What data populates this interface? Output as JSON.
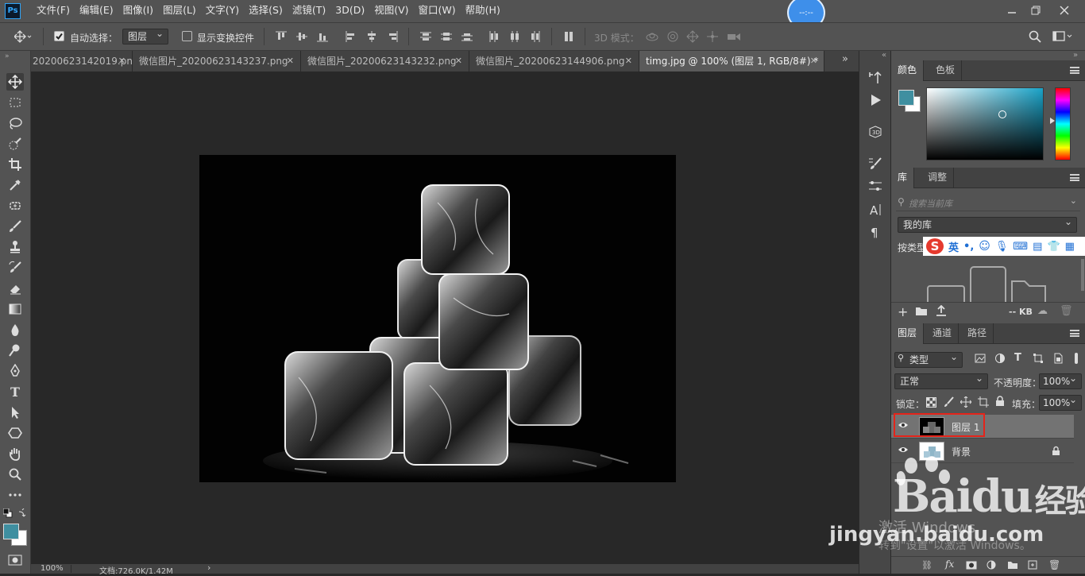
{
  "app": {
    "logo": "Ps",
    "clock": "--:--"
  },
  "menu": [
    "文件(F)",
    "编辑(E)",
    "图像(I)",
    "图层(L)",
    "文字(Y)",
    "选择(S)",
    "滤镜(T)",
    "3D(D)",
    "视图(V)",
    "窗口(W)",
    "帮助(H)"
  ],
  "options": {
    "auto_select_label": "自动选择：",
    "auto_select_checked": true,
    "auto_select_value": "图层",
    "show_transform_label": "显示变换控件",
    "show_transform_checked": false,
    "mode3d_label": "3D 模式："
  },
  "tabs": [
    {
      "label": "20200623142019.png",
      "active": false
    },
    {
      "label": "微信图片_20200623143237.png",
      "active": false
    },
    {
      "label": "微信图片_20200623143232.png",
      "active": false
    },
    {
      "label": "微信图片_20200623144906.png",
      "active": false
    },
    {
      "label": "timg.jpg @ 100% (图层 1, RGB/8#) *",
      "active": true
    }
  ],
  "status": {
    "zoom": "100%",
    "doc": "文档:726.0K/1.42M"
  },
  "colors": {
    "foreground": "#3f8fa0",
    "background": "#ffffff",
    "picker_hue": "#1aa3c8"
  },
  "color_panel": {
    "tabs": [
      "颜色",
      "色板"
    ]
  },
  "library_panel": {
    "tabs": [
      "库",
      "调整"
    ],
    "search_placeholder": "搜索当前库",
    "library_name": "我的库",
    "group_by": "按类型",
    "size": "-- KB"
  },
  "ime": [
    "英",
    "•,"
  ],
  "layers_panel": {
    "tabs": [
      "图层",
      "通道",
      "路径"
    ],
    "filter": "类型",
    "blend": "正常",
    "opacity_label": "不透明度：",
    "opacity": "100%",
    "lock_label": "锁定：",
    "fill_label": "填充：",
    "fill": "100%",
    "layers": [
      {
        "name": "图层 1",
        "selected": true,
        "locked": false
      },
      {
        "name": "背景",
        "selected": false,
        "locked": true
      }
    ]
  },
  "watermark": {
    "brand": "Baidu",
    "suffix": "经验",
    "site": "jingyan.baidu.com",
    "activate1": "激活 Windows",
    "activate2": "转到\"设置\"以激活 Windows。"
  }
}
